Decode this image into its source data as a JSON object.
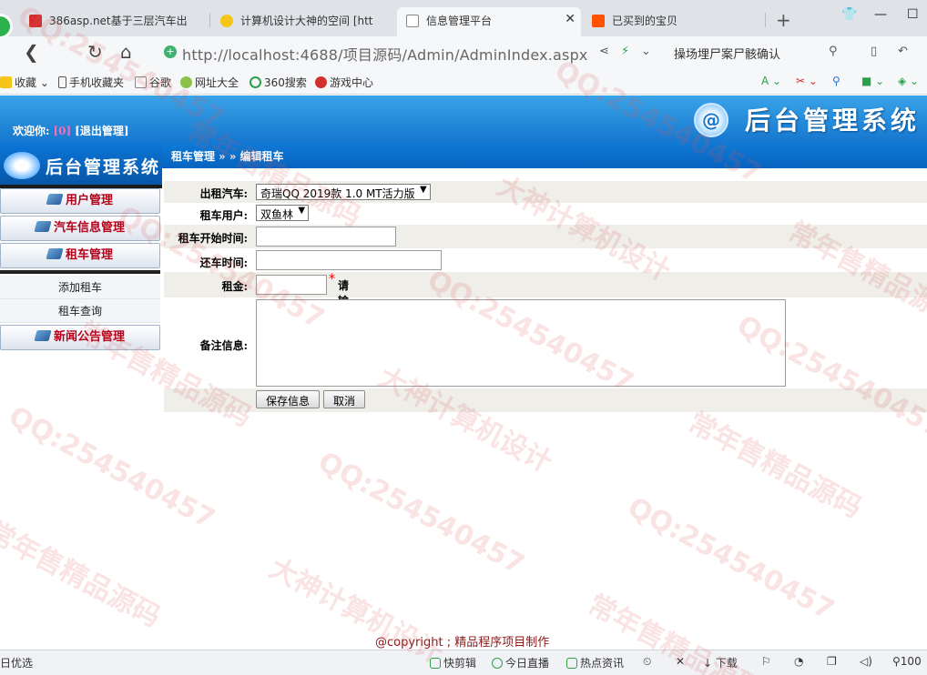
{
  "browser": {
    "tabs": [
      {
        "title": "386asp.net基于三层汽车出",
        "active": false
      },
      {
        "title": "计算机设计大神的空间 [htt",
        "active": false
      },
      {
        "title": "信息管理平台",
        "active": true
      },
      {
        "title": "已买到的宝贝",
        "active": false
      }
    ],
    "new_tab": "+",
    "window_controls": {
      "minimize": "—",
      "maximize": "☐"
    },
    "url": "http://localhost:4688/项目源码/Admin/AdminIndex.aspx",
    "search_text": "操场埋尸案尸骸确认",
    "bookmarks": [
      "收藏",
      "手机收藏夹",
      "谷歌",
      "网址大全",
      "360搜索",
      "游戏中心"
    ]
  },
  "header": {
    "welcome_label": "欢迎你:",
    "username": "[0]",
    "logout_label": "[退出管理]",
    "brand_title": "后台管理系统",
    "logo_char": "@"
  },
  "sidebar": {
    "title": "后台管理系统",
    "menus": [
      {
        "label": "用户管理"
      },
      {
        "label": "汽车信息管理"
      },
      {
        "label": "租车管理"
      }
    ],
    "submenu": [
      "添加租车",
      "租车查询"
    ],
    "news_menu": "新闻公告管理"
  },
  "breadcrumb": "租车管理 » » 编辑租车",
  "form": {
    "car_label": "出租汽车:",
    "car_value": "奇瑞QQ 2019款 1.0 MT活力版",
    "user_label": "租车用户:",
    "user_value": "双鱼林",
    "start_label": "租车开始时间:",
    "start_value": "",
    "return_label": "还车时间:",
    "return_value": "",
    "rent_label": "租金:",
    "rent_value": "",
    "rent_required": "*",
    "rent_hint": "请输入租金!",
    "remark_label": "备注信息:",
    "remark_value": "",
    "save_button": "保存信息",
    "cancel_button": "取消"
  },
  "footer": {
    "copyright": "@copyright ; 精品程序项目制作"
  },
  "statusbar": {
    "left": "日优选",
    "items": [
      "快剪辑",
      "今日直播",
      "热点资讯",
      "下载",
      "100"
    ]
  },
  "watermark": {
    "qq": "QQ:254540457",
    "text1": "大神计算机设计",
    "text2": "常年售精品源码"
  }
}
